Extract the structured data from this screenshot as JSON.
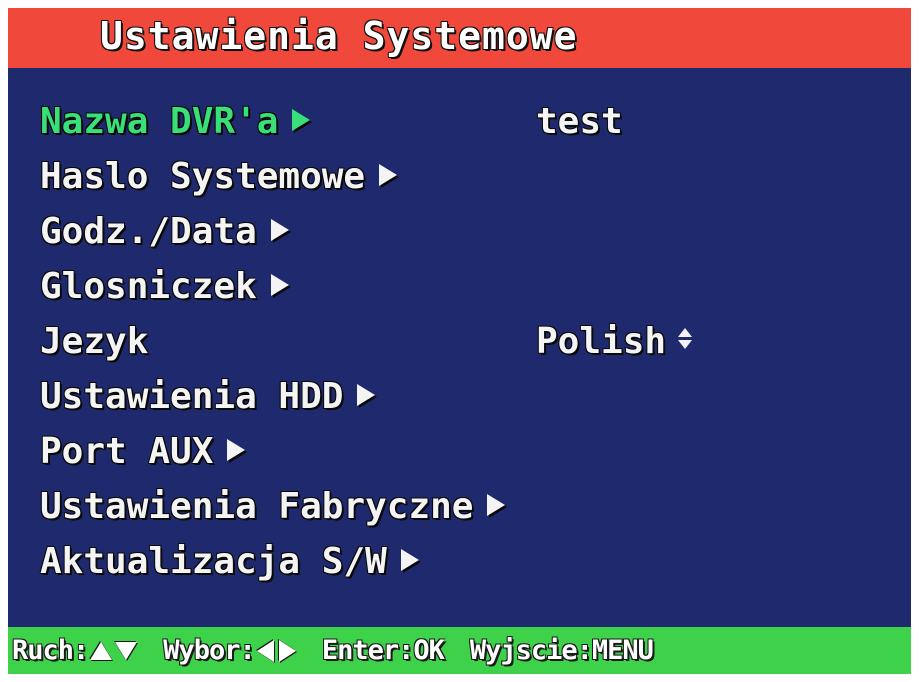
{
  "title": "Ustawienia Systemowe",
  "menu": {
    "items": [
      {
        "label": "Nazwa DVR'a",
        "value": "test",
        "selected": true
      },
      {
        "label": "Haslo Systemowe"
      },
      {
        "label": "Godz./Data"
      },
      {
        "label": "Glosniczek"
      },
      {
        "label": "Jezyk",
        "value": "Polish"
      },
      {
        "label": "Ustawienia HDD"
      },
      {
        "label": "Port AUX"
      },
      {
        "label": "Ustawienia Fabryczne"
      },
      {
        "label": "Aktualizacja S/W"
      }
    ]
  },
  "footer": {
    "move_label": "Ruch:",
    "select_label": "Wybor:",
    "enter_label": "Enter:OK",
    "exit_label": "Wyjscie:MENU"
  },
  "colors": {
    "title_bar": "#f0483a",
    "background": "#1f2a6e",
    "selected_text": "#39e07a",
    "footer_bar": "#3dd24a",
    "text": "#f4f4f4"
  },
  "icons": {
    "submenu": "arrow-right-icon",
    "option_toggle": "up-down-icon",
    "move": [
      "up-triangle-icon",
      "down-triangle-icon"
    ],
    "select": [
      "left-triangle-icon",
      "right-triangle-icon"
    ]
  }
}
